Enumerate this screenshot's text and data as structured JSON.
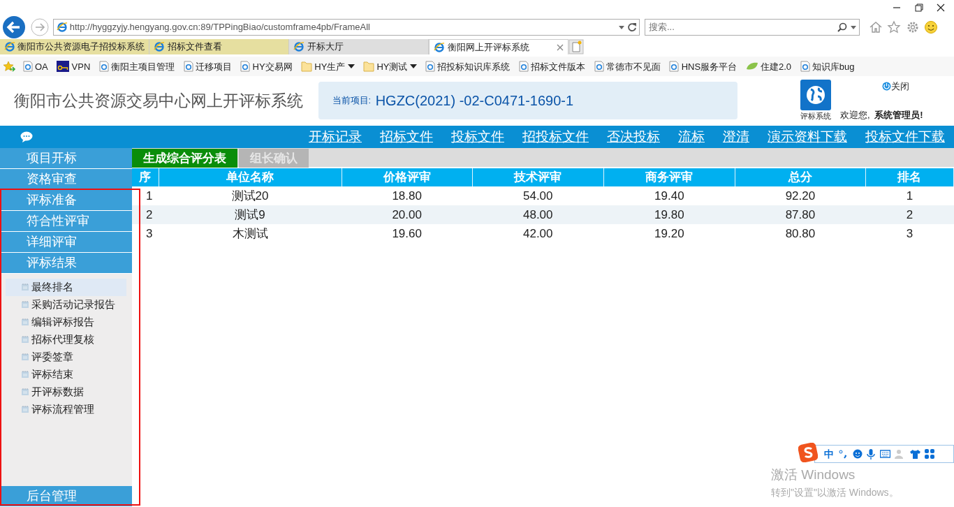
{
  "browser": {
    "address": "http://hyggzyjy.hengyang.gov.cn:89/TPPingBiao/customframe4pb/FrameAll",
    "search": {
      "placeholder": "搜索..."
    },
    "tabs": [
      {
        "label": "衡阳市公共资源电子招投标系统",
        "selected": false,
        "pinned": true
      },
      {
        "label": "招标文件查看",
        "selected": false,
        "pinned": true
      },
      {
        "label": "开标大厅",
        "selected": false,
        "pinned": false
      },
      {
        "label": "衡阳网上开评标系统",
        "selected": true,
        "pinned": false
      }
    ],
    "favorites": [
      {
        "label": "OA",
        "kind": "page"
      },
      {
        "label": "VPN",
        "kind": "vpn"
      },
      {
        "label": "衡阳主项目管理",
        "kind": "page"
      },
      {
        "label": "迁移项目",
        "kind": "page"
      },
      {
        "label": "HY交易网",
        "kind": "page"
      },
      {
        "label": "HY生产",
        "kind": "folder"
      },
      {
        "label": "HY测试",
        "kind": "folder"
      },
      {
        "label": "招投标知识库系统",
        "kind": "page"
      },
      {
        "label": "招标文件版本",
        "kind": "page"
      },
      {
        "label": "常德市不见面",
        "kind": "page"
      },
      {
        "label": "HNS服务平台",
        "kind": "page"
      },
      {
        "label": "住建2.0",
        "kind": "leaf"
      },
      {
        "label": "知识库bug",
        "kind": "page"
      }
    ]
  },
  "header": {
    "title": "衡阳市公共资源交易中心网上开评标系统",
    "project_label": "当前项目:",
    "project": "HGZC(2021) -02-C0471-1690-1",
    "system_label": "评标系统",
    "close": "关闭",
    "welcome": "欢迎您,",
    "user": "系统管理员!"
  },
  "nav": [
    "开标记录",
    "招标文件",
    "投标文件",
    "招投标文件",
    "否决投标",
    "流标",
    "澄清",
    "演示资料下载",
    "投标文件下载"
  ],
  "sidebar": {
    "sections": [
      {
        "label": "项目开标"
      },
      {
        "label": "资格审查"
      },
      {
        "label": "评标准备"
      },
      {
        "label": "符合性评审"
      },
      {
        "label": "详细评审"
      },
      {
        "label": "评标结果"
      }
    ],
    "items": [
      {
        "label": "最终排名",
        "selected": true
      },
      {
        "label": "采购活动记录报告",
        "selected": false
      },
      {
        "label": "编辑评标报告",
        "selected": false
      },
      {
        "label": "招标代理复核",
        "selected": false
      },
      {
        "label": "评委签章",
        "selected": false
      },
      {
        "label": "评标结束",
        "selected": false
      },
      {
        "label": "开评标数据",
        "selected": false
      },
      {
        "label": "评标流程管理",
        "selected": false
      }
    ],
    "footer": "后台管理"
  },
  "subtabs": [
    {
      "label": "生成综合评分表",
      "selected": true
    },
    {
      "label": "组长确认",
      "selected": false
    }
  ],
  "table": {
    "columns": [
      "序",
      "单位名称",
      "价格评审",
      "技术评审",
      "商务评审",
      "总分",
      "排名"
    ],
    "rows": [
      [
        "1",
        "测试20",
        "18.80",
        "54.00",
        "19.40",
        "92.20",
        "1"
      ],
      [
        "2",
        "测试9",
        "20.00",
        "48.00",
        "19.80",
        "87.80",
        "2"
      ],
      [
        "3",
        "木测试",
        "19.60",
        "42.00",
        "19.20",
        "80.80",
        "3"
      ]
    ]
  },
  "ime": {
    "mode": "中"
  },
  "activation": {
    "title": "激活 Windows",
    "text": "转到\"设置\"以激活 Windows。"
  }
}
